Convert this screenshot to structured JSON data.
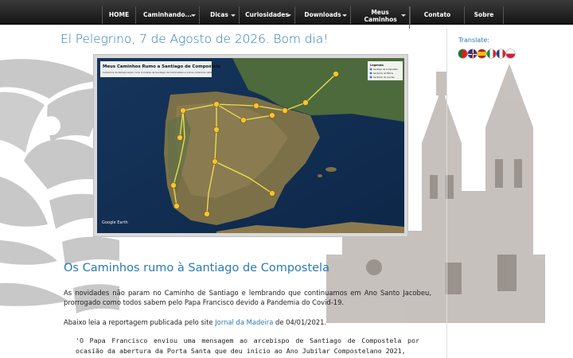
{
  "nav": {
    "items": [
      {
        "label": "HOME",
        "dropdown": false
      },
      {
        "label": "Caminhando...",
        "dropdown": true
      },
      {
        "label": "Dicas",
        "dropdown": true
      },
      {
        "label": "Curiosidades",
        "dropdown": true
      },
      {
        "label": "Downloads",
        "dropdown": true
      },
      {
        "label": "Meus Caminhos",
        "dropdown": true
      },
      {
        "label": "Contato",
        "dropdown": false
      },
      {
        "label": "Sobre",
        "dropdown": false
      }
    ]
  },
  "header": {
    "greeting": "El Pelegrino, 7 de Agosto de 2026. Bom dia!"
  },
  "map": {
    "title": "Meus Caminhos Rumo a Santiago de Compostela",
    "subtitle": "Caminhos de Peregrinação rumo à Cidade de Santiago de Compostela e outros caminhos católicos",
    "legend_title": "Legenda",
    "legend_items": [
      "Santiago de Compostela",
      "Santuário de Fátima",
      "Santuário de Lourdes"
    ],
    "watermark": "Google Earth"
  },
  "article": {
    "title": "Os Caminhos rumo à Santiago de Compostela",
    "para1": "As novidades não param no Caminho de Santiago e lembrando que continuamos em Ano Santo Jacobeu, prorrogado como todos sabem pelo Papa Francisco devido a Pandemia do Covid-19.",
    "para2_prefix": "Abaixo leia a reportagem publicada pelo site ",
    "para2_link": "Jornal da Madeira",
    "para2_suffix": " de 04/01/2021.",
    "quote": "'O Papa Francisco enviou uma mensagem ao arcebispo de Santiago de Compostela por ocasião da abertura da Porta Santa que deu início ao Ano Jubilar Compostelano 2021,"
  },
  "sidebar": {
    "translate_label": "Translate:",
    "flags": [
      "flag-portuguese-icon",
      "flag-english-icon",
      "flag-spanish-icon",
      "flag-italian-icon",
      "flag-french-icon",
      "flag-polish-icon"
    ]
  },
  "colors": {
    "link": "#2a7ab8",
    "nav_bg": "#1c1c1c"
  }
}
